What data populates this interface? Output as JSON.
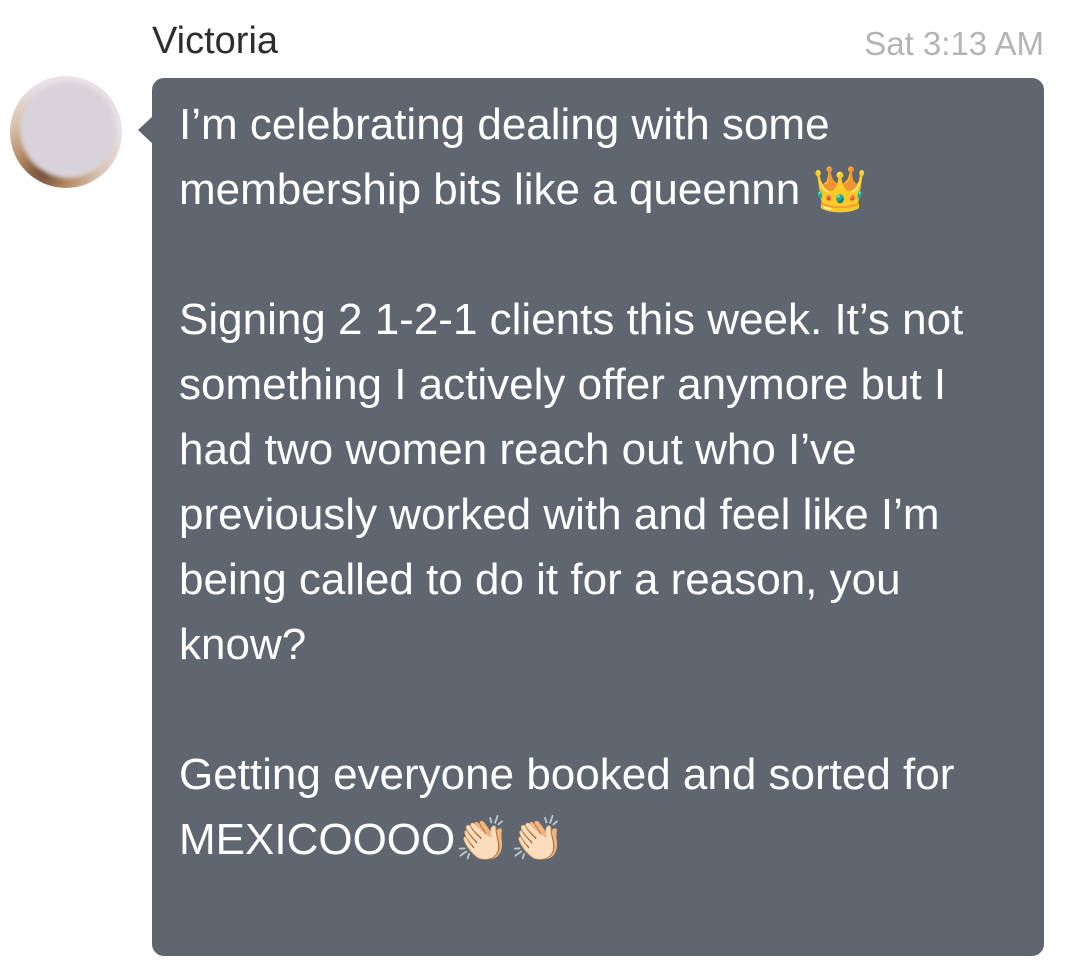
{
  "conversation": {
    "message": {
      "sender": "Victoria",
      "timestamp": "Sat 3:13 AM",
      "text": "I’m celebrating dealing with some membership bits like a queennn 👑\n\nSigning 2 1-2-1 clients this week. It’s not something I actively offer anymore but I had two women reach out who I’ve previously worked with and feel like I’m being called to do it for a reason, you know?\n\nGetting everyone booked and sorted for MEXICOOOO👏🏻👏🏻",
      "avatar": "blurred-profile-photo",
      "bubble_color": "#5f666f",
      "text_color": "#ffffff"
    }
  }
}
